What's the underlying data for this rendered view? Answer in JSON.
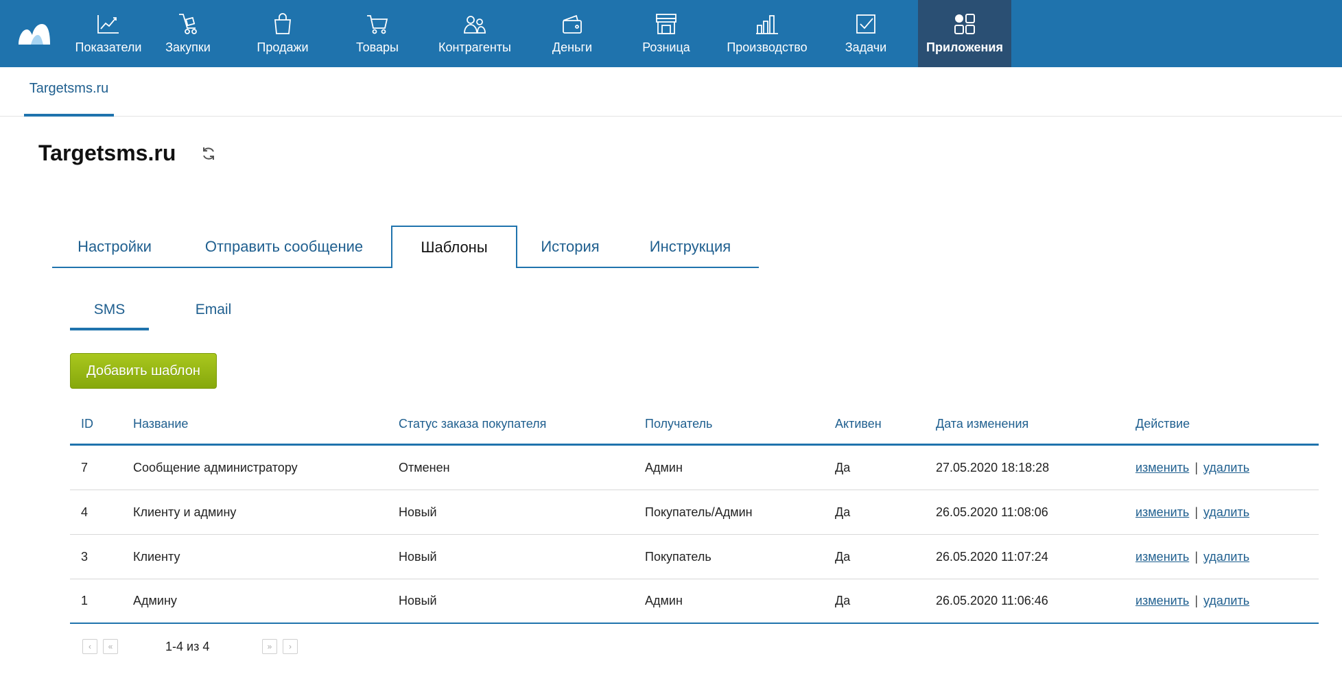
{
  "nav": {
    "items": [
      {
        "label": "Показатели",
        "icon": "chart-line-icon"
      },
      {
        "label": "Закупки",
        "icon": "cart-dolly-icon"
      },
      {
        "label": "Продажи",
        "icon": "shopping-bag-icon"
      },
      {
        "label": "Товары",
        "icon": "shopping-cart-icon"
      },
      {
        "label": "Контрагенты",
        "icon": "people-icon"
      },
      {
        "label": "Деньги",
        "icon": "wallet-icon"
      },
      {
        "label": "Розница",
        "icon": "store-icon"
      },
      {
        "label": "Производство",
        "icon": "factory-icon"
      },
      {
        "label": "Задачи",
        "icon": "checkbox-icon"
      },
      {
        "label": "Приложения",
        "icon": "apps-grid-icon"
      }
    ],
    "active_index": 9,
    "background": "#1f73ad",
    "active_background": "#2a4f73"
  },
  "app_tab": {
    "label": "Targetsms.ru"
  },
  "page": {
    "title": "Targetsms.ru"
  },
  "main_tabs": [
    {
      "label": "Настройки"
    },
    {
      "label": "Отправить сообщение"
    },
    {
      "label": "Шаблоны"
    },
    {
      "label": "История"
    },
    {
      "label": "Инструкция"
    }
  ],
  "main_tabs_active_index": 2,
  "sub_tabs": [
    {
      "label": "SMS"
    },
    {
      "label": "Email"
    }
  ],
  "sub_tabs_active_index": 0,
  "add_button": {
    "label": "Добавить шаблон",
    "color": "#96b813"
  },
  "table": {
    "headers": {
      "id": "ID",
      "name": "Название",
      "status": "Статус заказа покупателя",
      "recipient": "Получатель",
      "active": "Активен",
      "date": "Дата изменения",
      "action": "Действие"
    },
    "rows": [
      {
        "id": "7",
        "name": "Сообщение администратору",
        "status": "Отменен",
        "recipient": "Админ",
        "active": "Да",
        "date": "27.05.2020 18:18:28",
        "edit": "изменить",
        "delete": "удалить"
      },
      {
        "id": "4",
        "name": "Клиенту и админу",
        "status": "Новый",
        "recipient": "Покупатель/Админ",
        "active": "Да",
        "date": "26.05.2020 11:08:06",
        "edit": "изменить",
        "delete": "удалить"
      },
      {
        "id": "3",
        "name": "Клиенту",
        "status": "Новый",
        "recipient": "Покупатель",
        "active": "Да",
        "date": "26.05.2020 11:07:24",
        "edit": "изменить",
        "delete": "удалить"
      },
      {
        "id": "1",
        "name": "Админу",
        "status": "Новый",
        "recipient": "Админ",
        "active": "Да",
        "date": "26.05.2020 11:06:46",
        "edit": "изменить",
        "delete": "удалить"
      }
    ],
    "action_separator": "|"
  },
  "pager": {
    "text": "1-4 из 4",
    "prev": "‹",
    "first": "«",
    "next": "»",
    "last": "›"
  }
}
